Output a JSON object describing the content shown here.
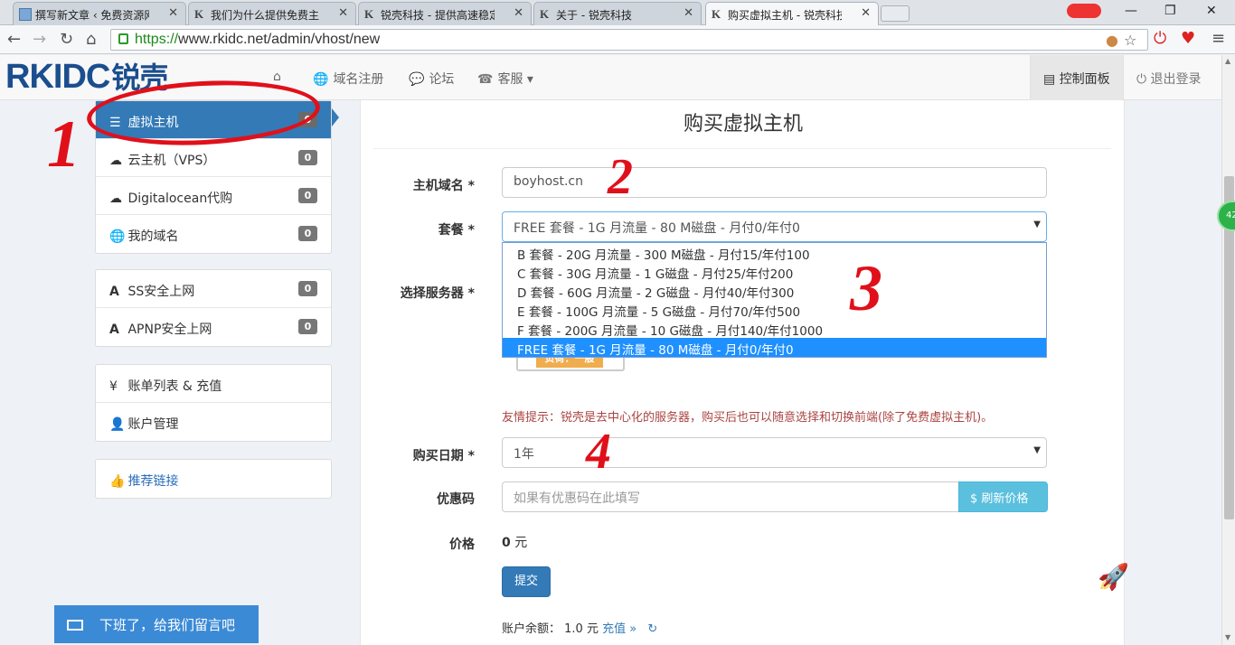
{
  "browser": {
    "tabs": [
      {
        "label": "撰写新文章 ‹ 免费资源网",
        "fav": "img"
      },
      {
        "label": "我们为什么提供免费主机",
        "fav": "K"
      },
      {
        "label": "锐壳科技 - 提供高速稳定",
        "fav": "K"
      },
      {
        "label": "关于 - 锐壳科技",
        "fav": "K"
      },
      {
        "label": "购买虚拟主机 - 锐壳科技",
        "fav": "K"
      }
    ],
    "url_scheme": "https://",
    "url_rest": "www.rkidc.net/admin/vhost/new",
    "win_min": "—",
    "win_max": "❐",
    "win_close": "✕"
  },
  "brand": {
    "logo_latin": "RKIDC",
    "logo_cn": "锐壳"
  },
  "nav": {
    "home_icon": "⌂",
    "items": [
      {
        "icon": "🌐",
        "label": "域名注册"
      },
      {
        "icon": "💬",
        "label": "论坛"
      },
      {
        "icon": "☎",
        "label": "客服 ▾"
      }
    ],
    "control_panel": "控制面板",
    "logout": "退出登录"
  },
  "sidebar": {
    "group1": [
      {
        "icon": "☰",
        "label": "虚拟主机",
        "count": "0",
        "active": true
      },
      {
        "icon": "☁",
        "label": "云主机（VPS）",
        "count": "0"
      },
      {
        "icon": "☁",
        "label": "Digitalocean代购",
        "count": "0"
      },
      {
        "icon": "🌐",
        "label": "我的域名",
        "count": "0"
      }
    ],
    "group2": [
      {
        "icon": "A",
        "label": "SS安全上网",
        "count": "0"
      },
      {
        "icon": "A",
        "label": "APNP安全上网",
        "count": "0"
      }
    ],
    "group3": [
      {
        "icon": "¥",
        "label": "账单列表 & 充值"
      },
      {
        "icon": "👤",
        "label": "账户管理"
      }
    ],
    "group4": [
      {
        "icon": "👍",
        "label": "推荐链接"
      }
    ]
  },
  "form": {
    "title": "购买虚拟主机",
    "domain_label": "主机域名 *",
    "domain_value": "boyhost.cn",
    "plan_label": "套餐 *",
    "plan_value": "FREE 套餐 - 1G 月流量 - 80 M磁盘 - 月付0/年付0",
    "plan_options": [
      "B 套餐 - 20G 月流量 - 300 M磁盘 - 月付15/年付100",
      "C 套餐 - 30G 月流量 - 1 G磁盘 - 月付25/年付200",
      "D 套餐 - 60G 月流量 - 2 G磁盘 - 月付40/年付300",
      "E 套餐 - 100G 月流量 - 5 G磁盘 - 月付70/年付500",
      "F 套餐 - 200G 月流量 - 10 G磁盘 - 月付140/年付1000",
      "FREE 套餐 - 1G 月流量 - 80 M磁盘 - 月付0/年付0"
    ],
    "server_label": "选择服务器 *",
    "server_load": "负荷：一般",
    "tip": "友情提示：锐壳是去中心化的服务器，购买后也可以随意选择和切换前端(除了免费虚拟主机)。",
    "period_label": "购买日期 *",
    "period_value": "1年",
    "coupon_label": "优惠码",
    "coupon_placeholder": "如果有优惠码在此填写",
    "refresh_label": "$ 刷新价格",
    "price_label": "价格",
    "price_value": "0",
    "price_unit": "元",
    "submit_label": "提交",
    "balance_label": "账户余额：",
    "balance_value": "1.0 元",
    "recharge_link": "充值 »"
  },
  "chat": {
    "label": "下班了，给我们留言吧"
  },
  "annotations": [
    "1",
    "2",
    "3",
    "4"
  ],
  "colors": {
    "primary": "#337ab7",
    "info": "#5bc0de",
    "warning": "#f0ad4e",
    "annotation": "#e0101a"
  }
}
